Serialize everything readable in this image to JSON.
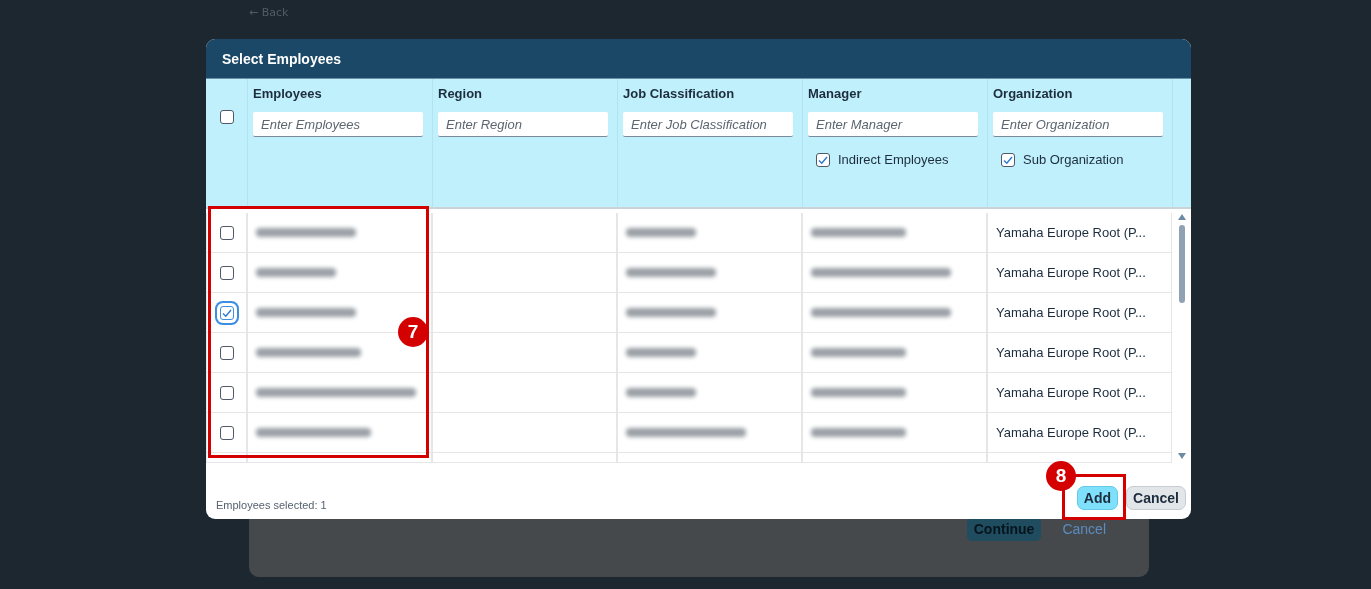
{
  "page": {
    "back_link": "← Back",
    "buttons": [
      {
        "label": "Continue",
        "kind": "primary"
      },
      {
        "label": "Cancel",
        "kind": "link"
      }
    ]
  },
  "dialog": {
    "title": "Select Employees",
    "select_all": {
      "checked": false
    },
    "columns": [
      {
        "label": "Employees",
        "placeholder": "Enter Employees"
      },
      {
        "label": "Region",
        "placeholder": "Enter Region"
      },
      {
        "label": "Job Classification",
        "placeholder": "Enter Job Classification"
      },
      {
        "label": "Manager",
        "placeholder": "Enter Manager",
        "option": {
          "label": "Indirect Employees",
          "checked": true
        }
      },
      {
        "label": "Organization",
        "placeholder": "Enter Organization",
        "option": {
          "label": "Sub Organization",
          "checked": true
        }
      }
    ],
    "rows": [
      {
        "selected": false,
        "organization": "Yamaha Europe Root (P..."
      },
      {
        "selected": false,
        "organization": "Yamaha Europe Root (P..."
      },
      {
        "selected": true,
        "organization": "Yamaha Europe Root (P..."
      },
      {
        "selected": false,
        "organization": "Yamaha Europe Root (P..."
      },
      {
        "selected": false,
        "organization": "Yamaha Europe Root (P..."
      },
      {
        "selected": false,
        "organization": "Yamaha Europe Root (P..."
      }
    ],
    "status": "Employees selected: 1",
    "buttons": [
      {
        "label": "Add",
        "kind": "primary"
      },
      {
        "label": "Cancel",
        "kind": "secondary"
      }
    ]
  },
  "annotations": [
    {
      "number": "7"
    },
    {
      "number": "8"
    }
  ]
}
